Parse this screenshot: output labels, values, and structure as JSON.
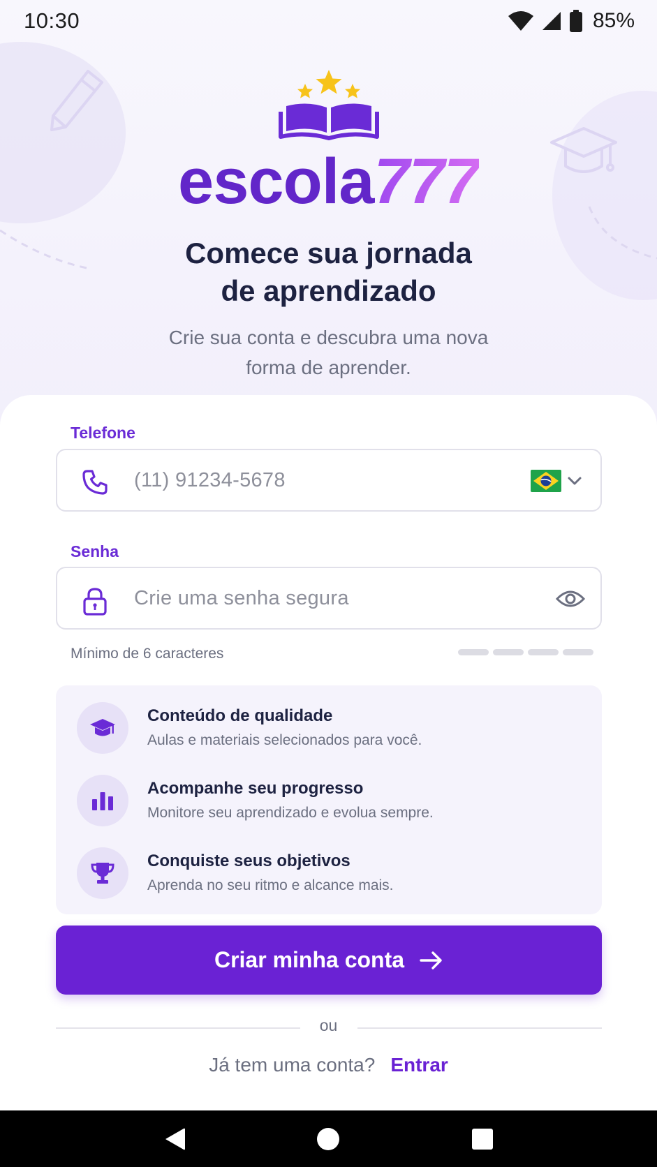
{
  "status_bar": {
    "time": "10:30",
    "battery": "85%"
  },
  "brand": {
    "name_part1": "escola",
    "name_part2": "777",
    "primary_color": "#6a22d4",
    "accent_color": "#d46cf2",
    "star_color": "#f7c31a"
  },
  "hero": {
    "headline_line1": "Comece sua jornada",
    "headline_line2": "de aprendizado",
    "subtitle_line1": "Crie sua conta e descubra uma nova",
    "subtitle_line2": "forma de aprender."
  },
  "form": {
    "phone": {
      "label": "Telefone",
      "placeholder": "(11) 91234-5678",
      "icon": "phone-icon",
      "country_flag": "brazil-flag-icon"
    },
    "password": {
      "label": "Senha",
      "placeholder": "Crie uma senha segura",
      "icon": "lock-icon",
      "toggle_icon": "eye-icon",
      "hint": "Mínimo de 6 caracteres",
      "strength_segments": 4,
      "strength_filled": 0
    }
  },
  "features": [
    {
      "icon": "graduation-cap-icon",
      "title": "Conteúdo de qualidade",
      "description": "Aulas e materiais selecionados para você."
    },
    {
      "icon": "bar-chart-icon",
      "title": "Acompanhe seu progresso",
      "description": "Monitore seu aprendizado e evolua sempre."
    },
    {
      "icon": "trophy-icon",
      "title": "Conquiste seus objetivos",
      "description": "Aprenda no seu ritmo e alcance mais."
    }
  ],
  "cta": {
    "label": "Criar minha conta",
    "icon": "arrow-right-icon"
  },
  "divider": {
    "text": "ou"
  },
  "login": {
    "question": "Já tem uma conta?",
    "link": "Entrar"
  }
}
